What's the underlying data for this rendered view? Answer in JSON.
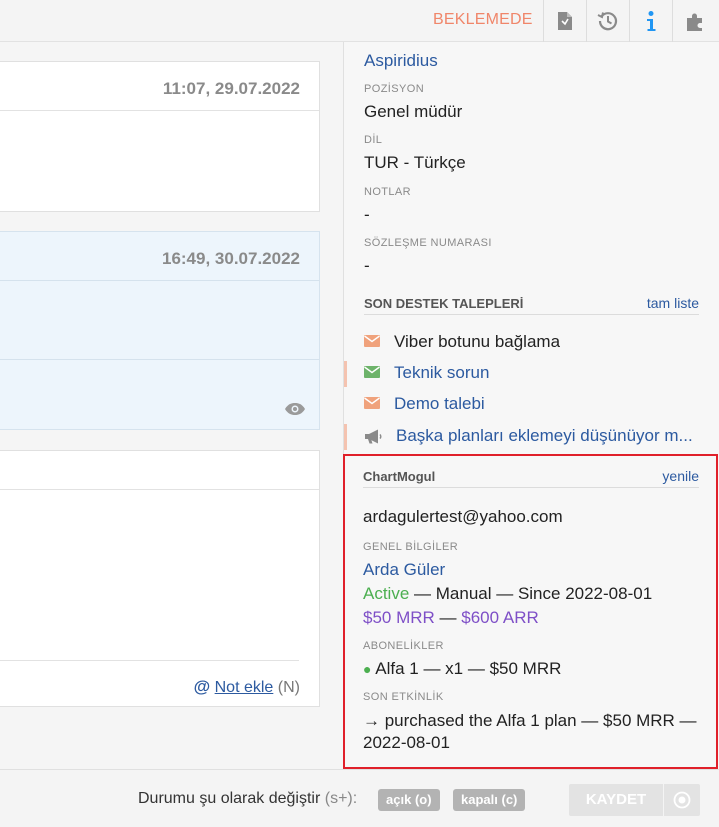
{
  "toolbar": {
    "status": "BEKLEMEDE",
    "icons": [
      "pdf-file-icon",
      "history-icon",
      "info-icon",
      "puzzle-icon"
    ],
    "colors": {
      "status": "#f0866a",
      "info": "#2196f3",
      "icon": "#8a8a8a"
    }
  },
  "conversation": {
    "messages": [
      {
        "time": "11:07, 29.07.2022"
      },
      {
        "time": "16:49, 30.07.2022"
      }
    ],
    "note": {
      "at": "@",
      "link": "Not ekle",
      "shortcut": "(N)"
    }
  },
  "contact": {
    "company_value": "Aspiridius",
    "position_label": "POZİSYON",
    "position_value": "Genel müdür",
    "language_label": "DİL",
    "language_value": "TUR - Türkçe",
    "notes_label": "NOTLAR",
    "notes_value": "-",
    "contract_label": "SÖZLEŞME NUMARASI",
    "contract_value": "-"
  },
  "tickets": {
    "header": "SON DESTEK TALEPLERİ",
    "full_list": "tam liste",
    "items": [
      {
        "icon": "envelope-icon",
        "title": "Viber botunu bağlama"
      },
      {
        "icon": "envelope-icon",
        "title": "Teknik sorun"
      },
      {
        "icon": "envelope-icon",
        "title": "Demo talebi"
      },
      {
        "icon": "megaphone-icon",
        "title": "Başka planları eklemeyi düşünüyor m..."
      }
    ]
  },
  "chartmogul": {
    "header": "ChartMogul",
    "refresh": "yenile",
    "email": "ardagulertest@yahoo.com",
    "general_label": "GENEL BİLGİLER",
    "name": "Arda Güler",
    "status": "Active",
    "status_rest": " — Manual — Since 2022-08-01",
    "mrr": "$50 MRR",
    "sep": " — ",
    "arr": "$600 ARR",
    "subs_label": "ABONELİKLER",
    "subscription": "Alfa 1 — x1 — $50 MRR",
    "activity_label": "SON ETKİNLİK",
    "activity": "→ purchased the Alfa 1 plan — $50 MRR — 2022-08-01",
    "colors": {
      "active": "#4caf50",
      "money": "#7e4fc7",
      "highlight": "#e0202a"
    }
  },
  "bottombar": {
    "change_label": "Durumu şu olarak değiştir",
    "change_hint": "(s+):",
    "open_label": "açık",
    "open_key": "(o)",
    "closed_label": "kapalı",
    "closed_key": "(c)",
    "save": "KAYDET"
  }
}
